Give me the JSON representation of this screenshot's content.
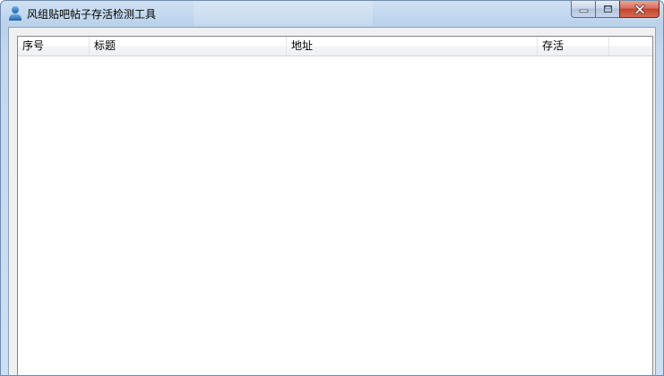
{
  "window": {
    "title": "风组贴吧帖子存活检测工具",
    "icon": "user-icon"
  },
  "caption_buttons": {
    "minimize_icon": "minimize-icon",
    "maximize_icon": "maximize-icon",
    "close_icon": "close-icon"
  },
  "listview": {
    "columns": [
      {
        "label": "序号"
      },
      {
        "label": "标题"
      },
      {
        "label": "地址"
      },
      {
        "label": "存活"
      }
    ],
    "rows": []
  },
  "colors": {
    "title_bar": "#b9d1ea",
    "close_button": "#c2452d",
    "list_background": "#ffffff"
  }
}
